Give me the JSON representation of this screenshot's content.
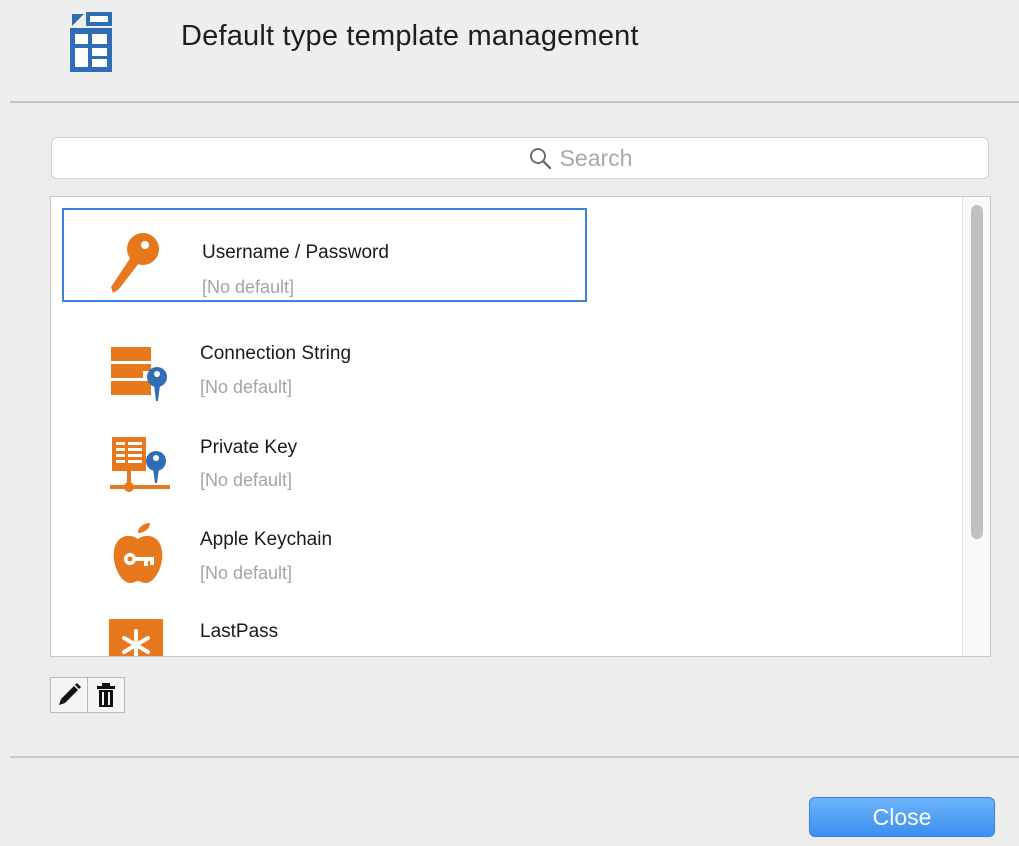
{
  "header": {
    "title": "Default type template management",
    "icon": "template-icon"
  },
  "search": {
    "placeholder": "Search",
    "icon": "search-icon"
  },
  "templates": [
    {
      "title": "Username / Password",
      "subtitle": "[No default]",
      "icon": "key-icon",
      "selected": true
    },
    {
      "title": "Connection String",
      "subtitle": "[No default]",
      "icon": "database-key-icon",
      "selected": false
    },
    {
      "title": "Private Key",
      "subtitle": "[No default]",
      "icon": "network-key-icon",
      "selected": false
    },
    {
      "title": "Apple Keychain",
      "subtitle": "[No default]",
      "icon": "apple-key-icon",
      "selected": false
    },
    {
      "title": "LastPass",
      "subtitle": "",
      "icon": "lastpass-icon",
      "selected": false
    }
  ],
  "toolbar": {
    "edit_icon": "pencil-icon",
    "delete_icon": "trash-icon"
  },
  "footer": {
    "close_label": "Close"
  },
  "colors": {
    "accent_orange": "#e8781e",
    "accent_blue": "#2f6eb5",
    "selection_blue": "#3b83dc",
    "button_blue": "#3a8ff1"
  }
}
